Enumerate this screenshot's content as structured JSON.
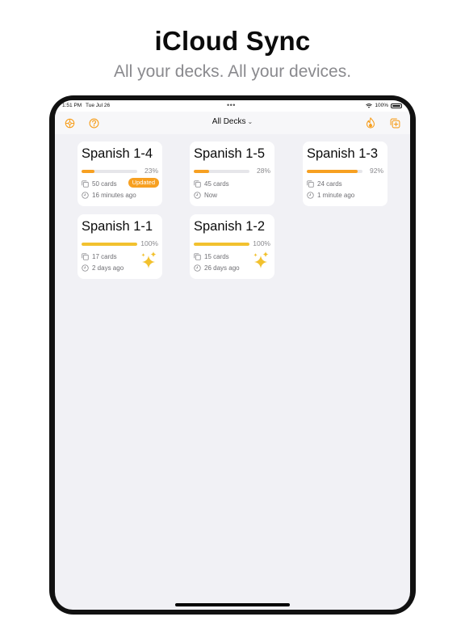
{
  "headline": "iCloud Sync",
  "subhead": "All your decks. All your devices.",
  "status": {
    "time": "1:51 PM",
    "date": "Tue Jul 26",
    "battery": "100%"
  },
  "nav": {
    "title": "All Decks",
    "left_icons": [
      "settings-icon",
      "help-icon"
    ],
    "right_icons": [
      "flame-icon",
      "new-deck-icon"
    ]
  },
  "accent_color": "#f7a021",
  "complete_color": "#f2c12e",
  "decks": [
    {
      "title": "Spanish 1-4",
      "progress": 23,
      "pct_label": "23%",
      "cards": "50 cards",
      "time": "16 minutes ago",
      "badge": "Updated"
    },
    {
      "title": "Spanish 1-5",
      "progress": 28,
      "pct_label": "28%",
      "cards": "45 cards",
      "time": "Now"
    },
    {
      "title": "Spanish 1-3",
      "progress": 92,
      "pct_label": "92%",
      "cards": "24 cards",
      "time": "1 minute ago"
    },
    {
      "title": "Spanish 1-1",
      "progress": 100,
      "pct_label": "100%",
      "cards": "17 cards",
      "time": "2 days ago",
      "sparkle": "sparkle-icon"
    },
    {
      "title": "Spanish 1-2",
      "progress": 100,
      "pct_label": "100%",
      "cards": "15 cards",
      "time": "26 days ago",
      "sparkle": "sparkle-icon"
    }
  ]
}
